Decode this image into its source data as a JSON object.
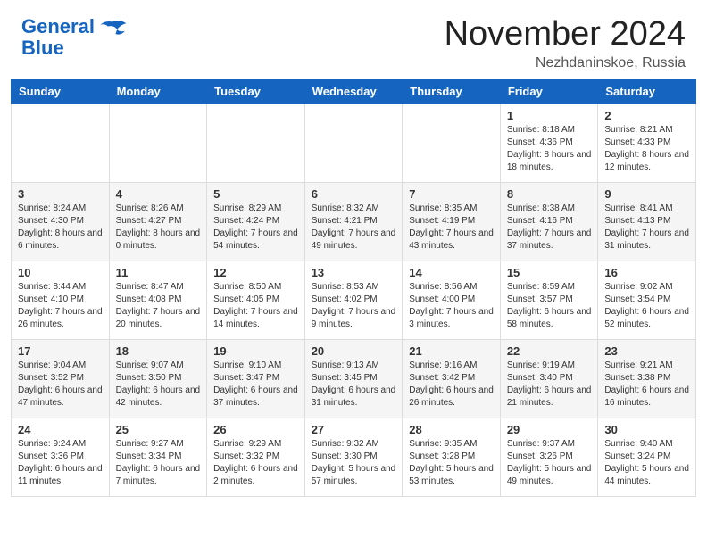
{
  "header": {
    "logo_line1": "General",
    "logo_line2": "Blue",
    "month_title": "November 2024",
    "subtitle": "Nezhdaninskoe, Russia"
  },
  "weekdays": [
    "Sunday",
    "Monday",
    "Tuesday",
    "Wednesday",
    "Thursday",
    "Friday",
    "Saturday"
  ],
  "weeks": [
    [
      {
        "day": "",
        "info": ""
      },
      {
        "day": "",
        "info": ""
      },
      {
        "day": "",
        "info": ""
      },
      {
        "day": "",
        "info": ""
      },
      {
        "day": "",
        "info": ""
      },
      {
        "day": "1",
        "info": "Sunrise: 8:18 AM\nSunset: 4:36 PM\nDaylight: 8 hours and 18 minutes."
      },
      {
        "day": "2",
        "info": "Sunrise: 8:21 AM\nSunset: 4:33 PM\nDaylight: 8 hours and 12 minutes."
      }
    ],
    [
      {
        "day": "3",
        "info": "Sunrise: 8:24 AM\nSunset: 4:30 PM\nDaylight: 8 hours and 6 minutes."
      },
      {
        "day": "4",
        "info": "Sunrise: 8:26 AM\nSunset: 4:27 PM\nDaylight: 8 hours and 0 minutes."
      },
      {
        "day": "5",
        "info": "Sunrise: 8:29 AM\nSunset: 4:24 PM\nDaylight: 7 hours and 54 minutes."
      },
      {
        "day": "6",
        "info": "Sunrise: 8:32 AM\nSunset: 4:21 PM\nDaylight: 7 hours and 49 minutes."
      },
      {
        "day": "7",
        "info": "Sunrise: 8:35 AM\nSunset: 4:19 PM\nDaylight: 7 hours and 43 minutes."
      },
      {
        "day": "8",
        "info": "Sunrise: 8:38 AM\nSunset: 4:16 PM\nDaylight: 7 hours and 37 minutes."
      },
      {
        "day": "9",
        "info": "Sunrise: 8:41 AM\nSunset: 4:13 PM\nDaylight: 7 hours and 31 minutes."
      }
    ],
    [
      {
        "day": "10",
        "info": "Sunrise: 8:44 AM\nSunset: 4:10 PM\nDaylight: 7 hours and 26 minutes."
      },
      {
        "day": "11",
        "info": "Sunrise: 8:47 AM\nSunset: 4:08 PM\nDaylight: 7 hours and 20 minutes."
      },
      {
        "day": "12",
        "info": "Sunrise: 8:50 AM\nSunset: 4:05 PM\nDaylight: 7 hours and 14 minutes."
      },
      {
        "day": "13",
        "info": "Sunrise: 8:53 AM\nSunset: 4:02 PM\nDaylight: 7 hours and 9 minutes."
      },
      {
        "day": "14",
        "info": "Sunrise: 8:56 AM\nSunset: 4:00 PM\nDaylight: 7 hours and 3 minutes."
      },
      {
        "day": "15",
        "info": "Sunrise: 8:59 AM\nSunset: 3:57 PM\nDaylight: 6 hours and 58 minutes."
      },
      {
        "day": "16",
        "info": "Sunrise: 9:02 AM\nSunset: 3:54 PM\nDaylight: 6 hours and 52 minutes."
      }
    ],
    [
      {
        "day": "17",
        "info": "Sunrise: 9:04 AM\nSunset: 3:52 PM\nDaylight: 6 hours and 47 minutes."
      },
      {
        "day": "18",
        "info": "Sunrise: 9:07 AM\nSunset: 3:50 PM\nDaylight: 6 hours and 42 minutes."
      },
      {
        "day": "19",
        "info": "Sunrise: 9:10 AM\nSunset: 3:47 PM\nDaylight: 6 hours and 37 minutes."
      },
      {
        "day": "20",
        "info": "Sunrise: 9:13 AM\nSunset: 3:45 PM\nDaylight: 6 hours and 31 minutes."
      },
      {
        "day": "21",
        "info": "Sunrise: 9:16 AM\nSunset: 3:42 PM\nDaylight: 6 hours and 26 minutes."
      },
      {
        "day": "22",
        "info": "Sunrise: 9:19 AM\nSunset: 3:40 PM\nDaylight: 6 hours and 21 minutes."
      },
      {
        "day": "23",
        "info": "Sunrise: 9:21 AM\nSunset: 3:38 PM\nDaylight: 6 hours and 16 minutes."
      }
    ],
    [
      {
        "day": "24",
        "info": "Sunrise: 9:24 AM\nSunset: 3:36 PM\nDaylight: 6 hours and 11 minutes."
      },
      {
        "day": "25",
        "info": "Sunrise: 9:27 AM\nSunset: 3:34 PM\nDaylight: 6 hours and 7 minutes."
      },
      {
        "day": "26",
        "info": "Sunrise: 9:29 AM\nSunset: 3:32 PM\nDaylight: 6 hours and 2 minutes."
      },
      {
        "day": "27",
        "info": "Sunrise: 9:32 AM\nSunset: 3:30 PM\nDaylight: 5 hours and 57 minutes."
      },
      {
        "day": "28",
        "info": "Sunrise: 9:35 AM\nSunset: 3:28 PM\nDaylight: 5 hours and 53 minutes."
      },
      {
        "day": "29",
        "info": "Sunrise: 9:37 AM\nSunset: 3:26 PM\nDaylight: 5 hours and 49 minutes."
      },
      {
        "day": "30",
        "info": "Sunrise: 9:40 AM\nSunset: 3:24 PM\nDaylight: 5 hours and 44 minutes."
      }
    ]
  ]
}
